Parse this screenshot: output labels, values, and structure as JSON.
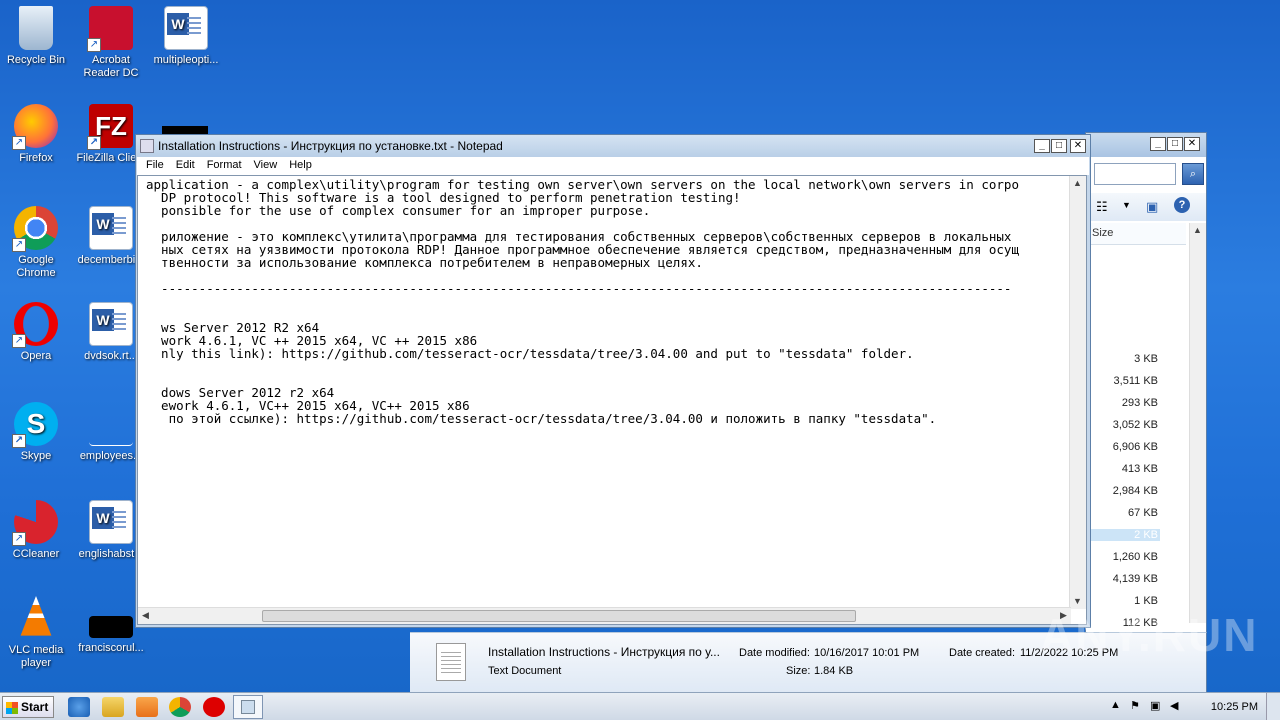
{
  "desktop_icons": [
    {
      "label": "Recycle Bin"
    },
    {
      "label": "Acrobat Reader DC"
    },
    {
      "label": "multipleopti..."
    },
    {
      "label": "Firefox"
    },
    {
      "label": "FileZilla Clie..."
    },
    {
      "label": "Google Chrome"
    },
    {
      "label": "decemberbi..."
    },
    {
      "label": "Opera"
    },
    {
      "label": "dvdsok.rt..."
    },
    {
      "label": "Skype"
    },
    {
      "label": "employees..."
    },
    {
      "label": "CCleaner"
    },
    {
      "label": "englishabst..."
    },
    {
      "label": "VLC media player"
    },
    {
      "label": "franciscorul..."
    }
  ],
  "notepad": {
    "title": "Installation Instructions - Инструкция по установке.txt - Notepad",
    "menu": [
      "File",
      "Edit",
      "Format",
      "View",
      "Help"
    ],
    "content": "application - a complex\\utility\\program for testing own server\\own servers on the local network\\own servers in corpo\n  DP protocol! This software is a tool designed to perform penetration testing!\n  ponsible for the use of complex consumer for an improper purpose.\n\n  риложение - это комплекс\\утилита\\программа для тестирования собственных серверов\\собственных серверов в локальных\n  ных сетях на уязвимости протокола RDP! Данное программное обеспечение является средством, предназначенным для осущ\n  твенности за использование комплекса потребителем в неправомерных целях.\n\n  -----------------------------------------------------------------------------------------------------------------\n\n\n  ws Server 2012 R2 x64\n  work 4.6.1, VC ++ 2015 x64, VC ++ 2015 x86\n  nly this link): https://github.com/tesseract-ocr/tessdata/tree/3.04.00 and put to \"tessdata\" folder.\n\n\n  dows Server 2012 r2 x64\n  ework 4.6.1, VC++ 2015 x64, VC++ 2015 x86\n   по этой ссылке): https://github.com/tesseract-ocr/tessdata/tree/3.04.00 и положить в папку \"tessdata\"."
  },
  "explorer": {
    "column_header": "Size",
    "sizes": [
      "3 KB",
      "3,511 KB",
      "293 KB",
      "3,052 KB",
      "6,906 KB",
      "413 KB",
      "2,984 KB",
      "67 KB",
      "2 KB",
      "1,260 KB",
      "4,139 KB",
      "1 KB",
      "112 KB"
    ],
    "selected_index": 8,
    "details": {
      "name": "Installation Instructions - Инструкция по у...",
      "type": "Text Document",
      "date_modified_label": "Date modified:",
      "date_modified": "10/16/2017 10:01 PM",
      "size_label": "Size:",
      "size": "1.84 KB",
      "date_created_label": "Date created:",
      "date_created": "11/2/2022 10:25 PM"
    }
  },
  "taskbar": {
    "start_label": "Start",
    "clock": "10:25 PM"
  },
  "watermark": "ANY.RUN"
}
